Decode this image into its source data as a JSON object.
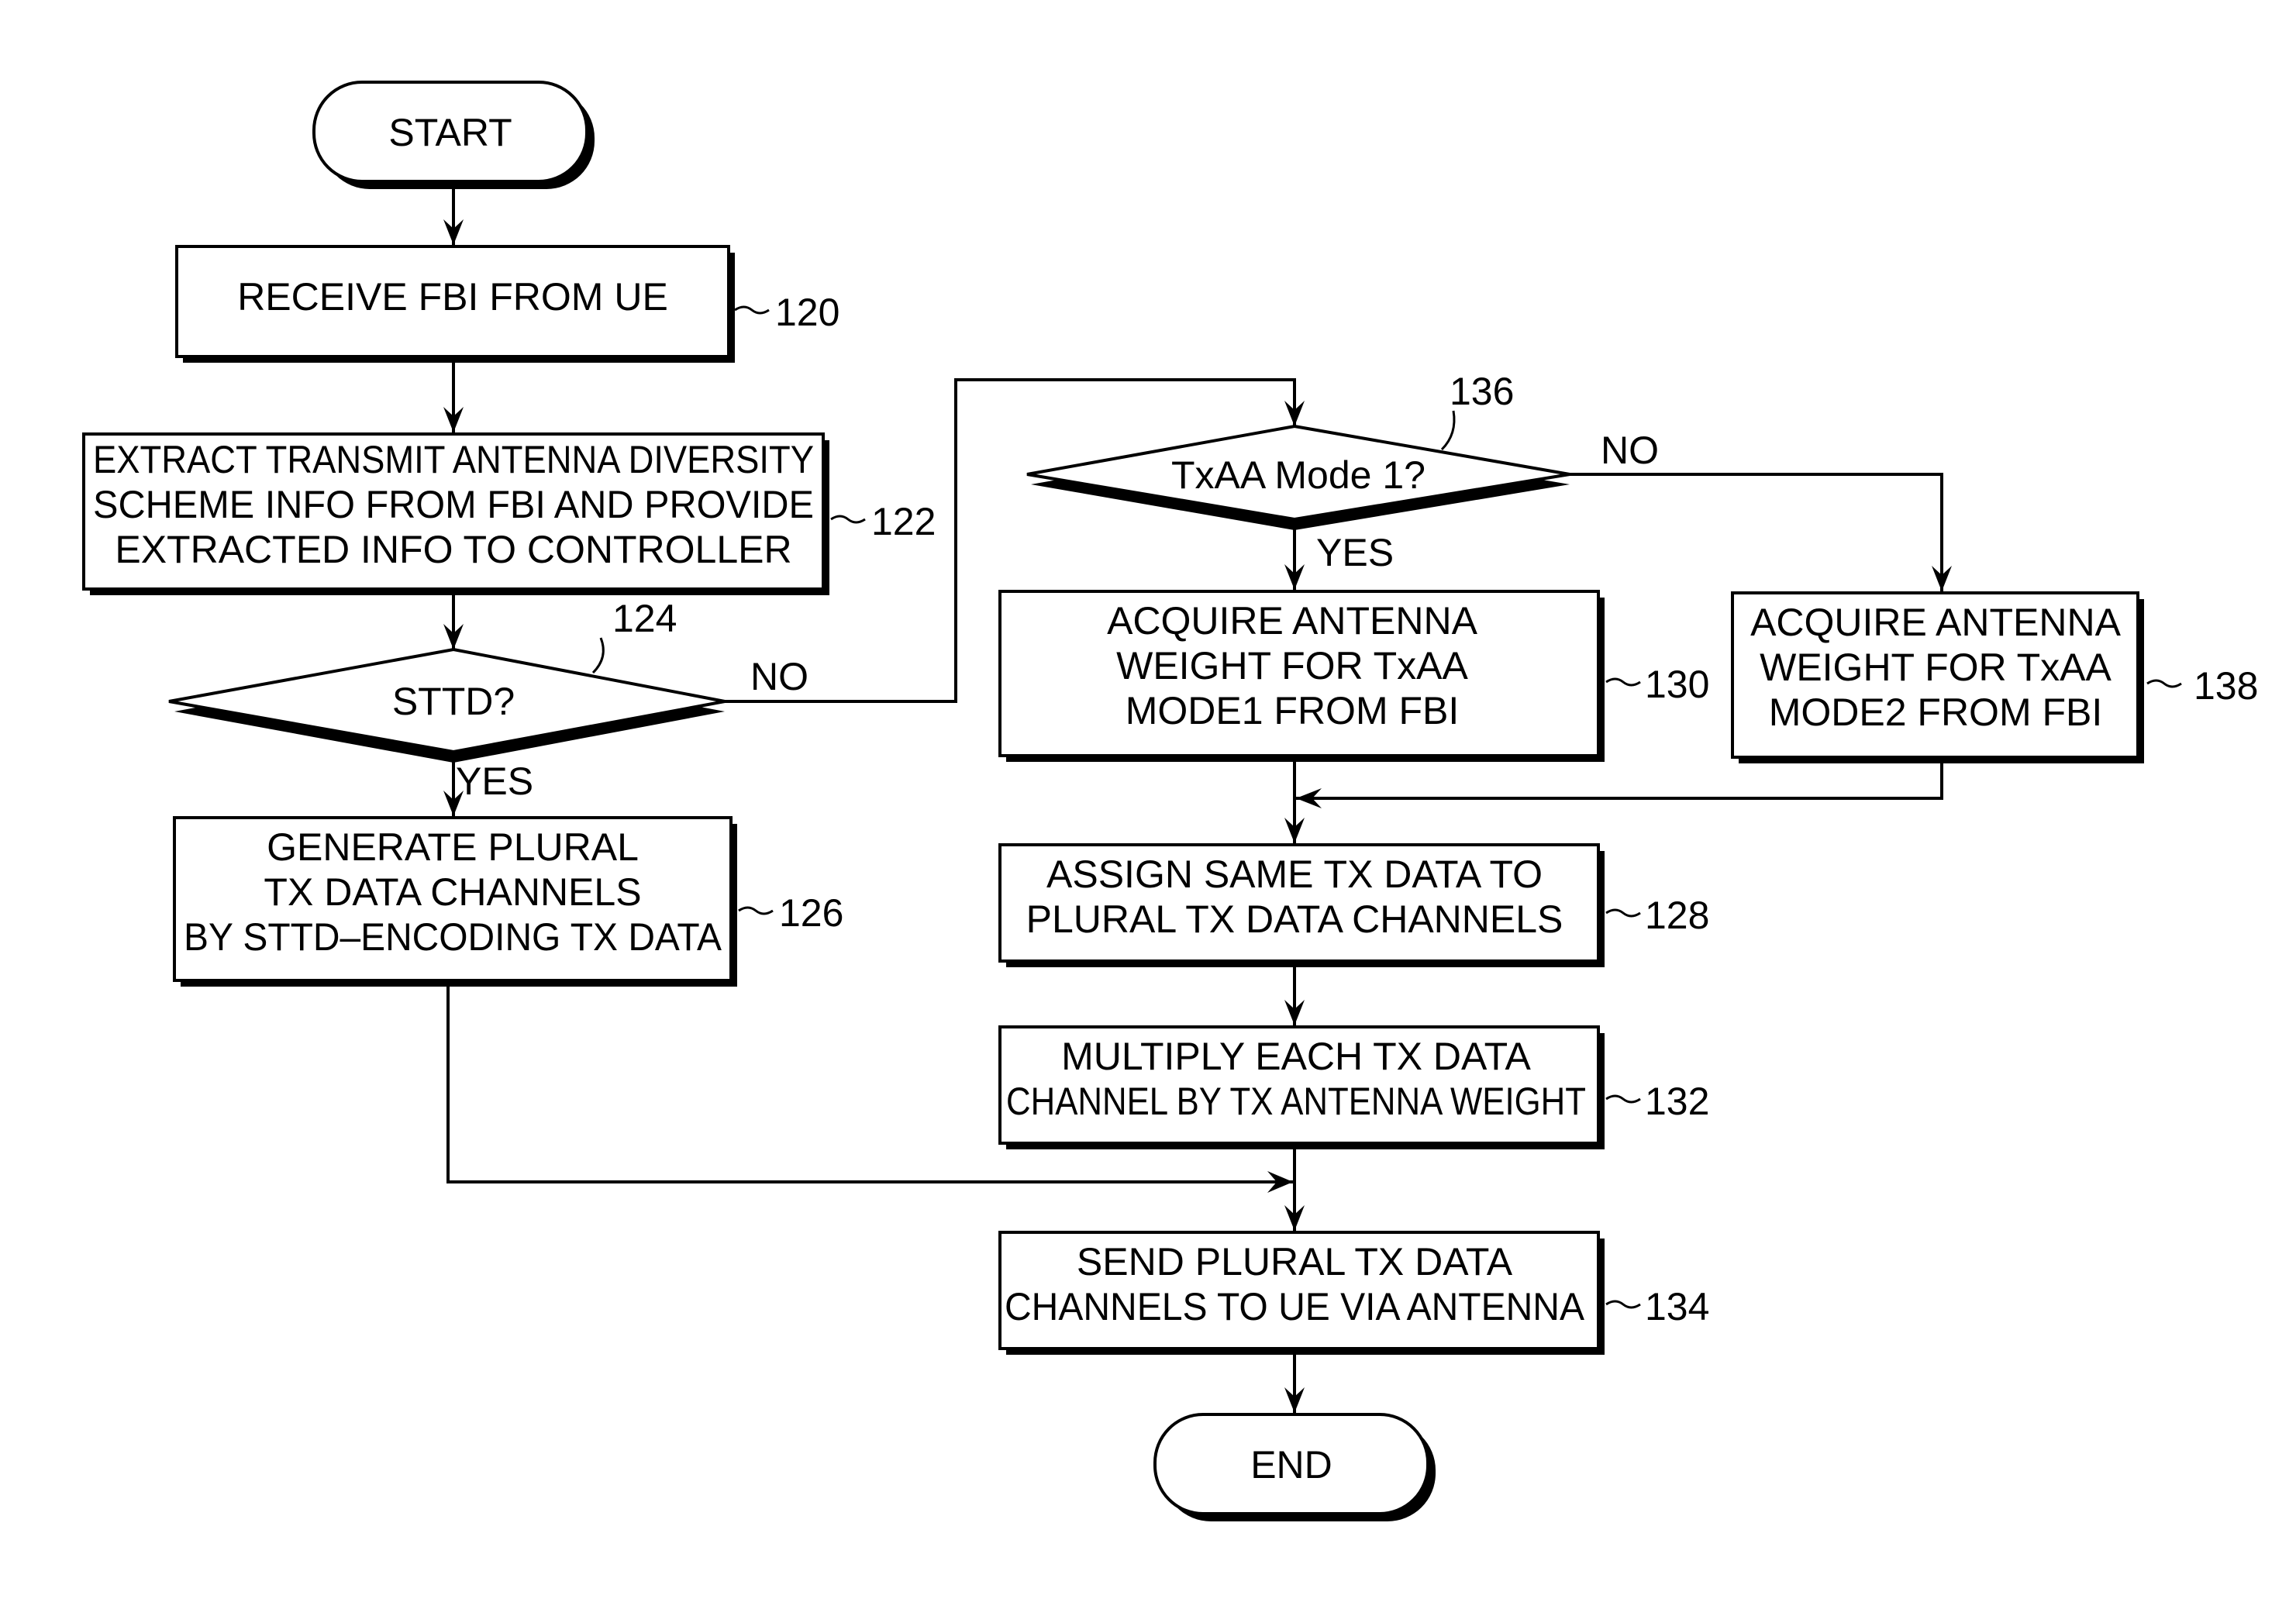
{
  "diagram": {
    "type": "flowchart",
    "nodes": {
      "start": {
        "label": "START"
      },
      "n120": {
        "lines": [
          "RECEIVE FBI FROM UE"
        ],
        "ref": "120"
      },
      "n122": {
        "lines": [
          "EXTRACT TRANSMIT ANTENNA DIVERSITY",
          "SCHEME INFO FROM FBI AND PROVIDE",
          "EXTRACTED INFO TO CONTROLLER"
        ],
        "ref": "122"
      },
      "n124": {
        "label": "STTD?",
        "ref": "124",
        "yes": "YES",
        "no": "NO"
      },
      "n126": {
        "lines": [
          "GENERATE PLURAL",
          "TX DATA CHANNELS",
          "BY STTD–ENCODING TX DATA"
        ],
        "ref": "126"
      },
      "n136": {
        "label": "TxAA Mode 1?",
        "ref": "136",
        "yes": "YES",
        "no": "NO"
      },
      "n130": {
        "lines": [
          "ACQUIRE ANTENNA",
          "WEIGHT FOR TxAA",
          "MODE1 FROM FBI"
        ],
        "ref": "130"
      },
      "n138": {
        "lines": [
          "ACQUIRE ANTENNA",
          "WEIGHT FOR TxAA",
          "MODE2 FROM FBI"
        ],
        "ref": "138"
      },
      "n128": {
        "lines": [
          "ASSIGN SAME TX DATA TO",
          "PLURAL TX DATA CHANNELS"
        ],
        "ref": "128"
      },
      "n132": {
        "lines": [
          "MULTIPLY EACH TX DATA",
          "CHANNEL BY TX ANTENNA WEIGHT"
        ],
        "ref": "132"
      },
      "n134": {
        "lines": [
          "SEND PLURAL TX DATA",
          "CHANNELS TO UE VIA ANTENNA"
        ],
        "ref": "134"
      },
      "end": {
        "label": "END"
      }
    },
    "edges": [
      {
        "from": "start",
        "to": "n120"
      },
      {
        "from": "n120",
        "to": "n122"
      },
      {
        "from": "n122",
        "to": "n124"
      },
      {
        "from": "n124",
        "to": "n126",
        "label": "YES"
      },
      {
        "from": "n124",
        "to": "n136",
        "label": "NO"
      },
      {
        "from": "n136",
        "to": "n130",
        "label": "YES"
      },
      {
        "from": "n136",
        "to": "n138",
        "label": "NO"
      },
      {
        "from": "n130",
        "to": "n128"
      },
      {
        "from": "n138",
        "to": "n128"
      },
      {
        "from": "n128",
        "to": "n132"
      },
      {
        "from": "n126",
        "to": "n134"
      },
      {
        "from": "n132",
        "to": "n134"
      },
      {
        "from": "n134",
        "to": "end"
      }
    ]
  }
}
